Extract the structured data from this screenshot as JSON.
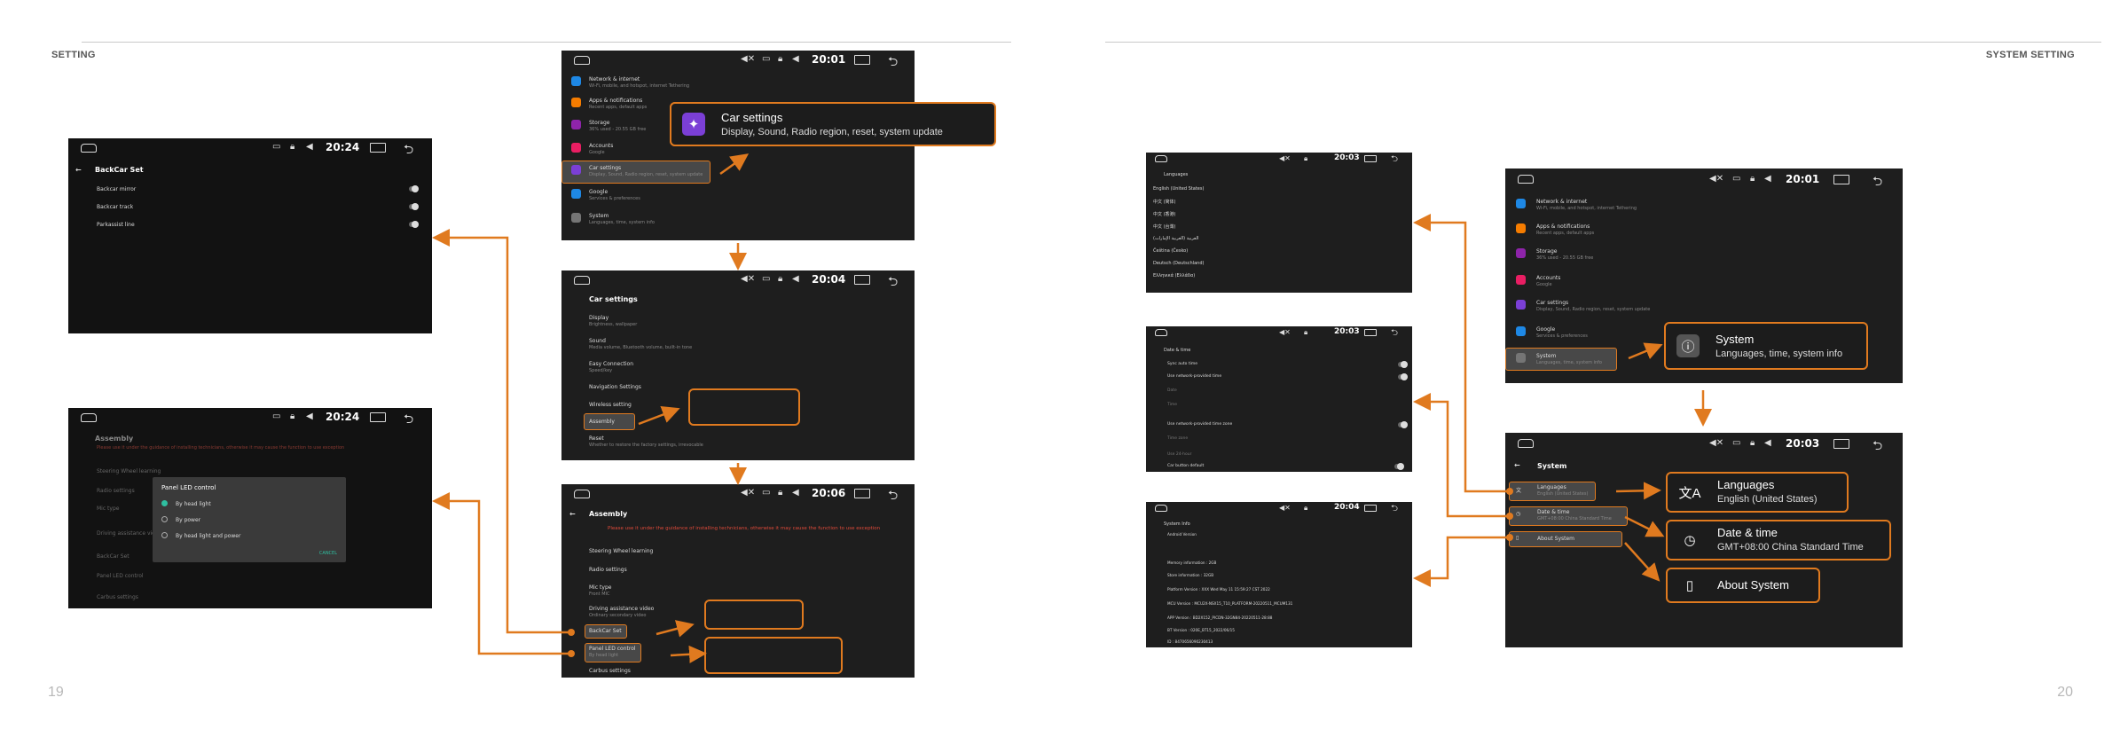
{
  "left_page": {
    "header": "SETTING",
    "page_number": "19"
  },
  "right_page": {
    "header": "SYSTEM SETTING",
    "page_number": "20"
  },
  "screens": {
    "backcar": {
      "time": "20:24",
      "title": "BackCar Set",
      "rows": [
        "Backcar mirror",
        "Backcar track",
        "Parkassist line"
      ]
    },
    "panel_led": {
      "time": "20:24",
      "title": "Assembly",
      "warning": "Please use it under the guidance of installing technicians, otherwise it may cause the function to use exception",
      "bg_rows": [
        "Steering Wheel learning",
        "Radio settings",
        "Mic type",
        "Driving assistance video",
        "BackCar Set",
        "Panel LED control",
        "Carbus settings"
      ],
      "dialog_title": "Panel LED control",
      "options": [
        "By head light",
        "By power",
        "By head light and power"
      ],
      "cancel": "CANCEL"
    },
    "settings_main": {
      "time": "20:01",
      "items": [
        {
          "title": "Network & internet",
          "sub": "Wi-Fi, mobile, and hotspot, internet Tethering",
          "color": "#1e88e5"
        },
        {
          "title": "Apps & notifications",
          "sub": "Recent apps, default apps",
          "color": "#f57c00"
        },
        {
          "title": "Storage",
          "sub": "36% used - 20.55 GB free",
          "color": "#8e24aa"
        },
        {
          "title": "Accounts",
          "sub": "Google",
          "color": "#e91e63"
        },
        {
          "title": "Car settings",
          "sub": "Display, Sound, Radio region, reset, system update",
          "color": "#7b3fd6"
        },
        {
          "title": "Google",
          "sub": "Services & preferences",
          "color": "#1e88e5"
        },
        {
          "title": "System",
          "sub": "Languages, time, system info",
          "color": "#757575"
        }
      ],
      "callout_title": "Car settings",
      "callout_sub": "Display, Sound, Radio region, reset, system update"
    },
    "car_settings": {
      "time": "20:04",
      "title": "Car settings",
      "items": [
        {
          "title": "Display",
          "sub": "Brightness, wallpaper"
        },
        {
          "title": "Sound",
          "sub": "Media volume, Bluetooth volume, built-in tone"
        },
        {
          "title": "Easy Connection",
          "sub": "Speed/key"
        },
        {
          "title": "Navigation Settings",
          "sub": ""
        },
        {
          "title": "Wireless setting",
          "sub": ""
        },
        {
          "title": "Assembly",
          "sub": ""
        },
        {
          "title": "Reset",
          "sub": "Whether to restore the factory settings, irrevocable"
        }
      ]
    },
    "assembly": {
      "time": "20:06",
      "title": "Assembly",
      "warning": "Please use it under the guidance of installing technicians, otherwise it may cause the function to use exception",
      "items": [
        {
          "title": "Steering Wheel learning",
          "sub": ""
        },
        {
          "title": "Radio settings",
          "sub": ""
        },
        {
          "title": "Mic type",
          "sub": "Front MIC"
        },
        {
          "title": "Driving assistance video",
          "sub": "Ordinary secondary video"
        },
        {
          "title": "BackCar Set",
          "sub": ""
        },
        {
          "title": "Panel LED control",
          "sub": "By head light"
        },
        {
          "title": "Carbus settings",
          "sub": ""
        }
      ]
    },
    "languages": {
      "time": "20:03",
      "title": "Languages",
      "items": [
        "English (United States)",
        "中文 (简体)",
        "中文 (香港)",
        "中文 (台灣)",
        "العربية (العربية الإمارات)",
        "Čeština (Česko)",
        "Deutsch (Deutschland)",
        "Ελληνικά (Ελλάδα)"
      ]
    },
    "datetime": {
      "time": "20:03",
      "title": "Date & time",
      "items": [
        "Sync auto time",
        "Use network-provided time",
        "Date",
        "Time",
        "Use network-provided time zone",
        "Time zone",
        "Use 24-hour",
        "Car button default"
      ]
    },
    "sysinfo": {
      "time": "20:04",
      "title": "System Info",
      "items": [
        "Android Version",
        "Memory information : 2GB",
        "Store information : 32GB",
        "Platform Version : XXX Wed May 11 15:59:27 CST 2022",
        "MCU Version : MCU2X-NSX15_T10_PLATFORM-20220511_MCUM131",
        "APP Version : BD2X152_PICDN-32GN84-20220511-28:88",
        "BT Version : 020E_BT15_2022/06/15",
        "ID : 8470656090230413"
      ]
    },
    "settings_main_r": {
      "time": "20:01",
      "items": [
        {
          "title": "Network & internet",
          "sub": "Wi-Fi, mobile, and hotspot, internet Tethering",
          "color": "#1e88e5"
        },
        {
          "title": "Apps & notifications",
          "sub": "Recent apps, default apps",
          "color": "#f57c00"
        },
        {
          "title": "Storage",
          "sub": "36% used - 20.55 GB free",
          "color": "#8e24aa"
        },
        {
          "title": "Accounts",
          "sub": "Google",
          "color": "#e91e63"
        },
        {
          "title": "Car settings",
          "sub": "Display, Sound, Radio region, reset, system update",
          "color": "#7b3fd6"
        },
        {
          "title": "Google",
          "sub": "Services & preferences",
          "color": "#1e88e5"
        },
        {
          "title": "System",
          "sub": "Languages, time, system info",
          "color": "#757575"
        }
      ],
      "callout_title": "System",
      "callout_sub": "Languages, time, system info"
    },
    "system": {
      "time": "20:03",
      "title": "System",
      "items": [
        {
          "title": "Languages",
          "sub": "English (United States)"
        },
        {
          "title": "Date & time",
          "sub": "GMT+08:00 China Standard Time"
        },
        {
          "title": "About System",
          "sub": ""
        }
      ],
      "callouts": [
        {
          "title": "Languages",
          "sub": "English (United States)"
        },
        {
          "title": "Date & time",
          "sub": "GMT+08:00 China Standard Time"
        },
        {
          "title": "About System",
          "sub": ""
        }
      ]
    }
  },
  "colors": {
    "accent": "#e07a1f",
    "screen_bg": "#1e1e1e"
  }
}
